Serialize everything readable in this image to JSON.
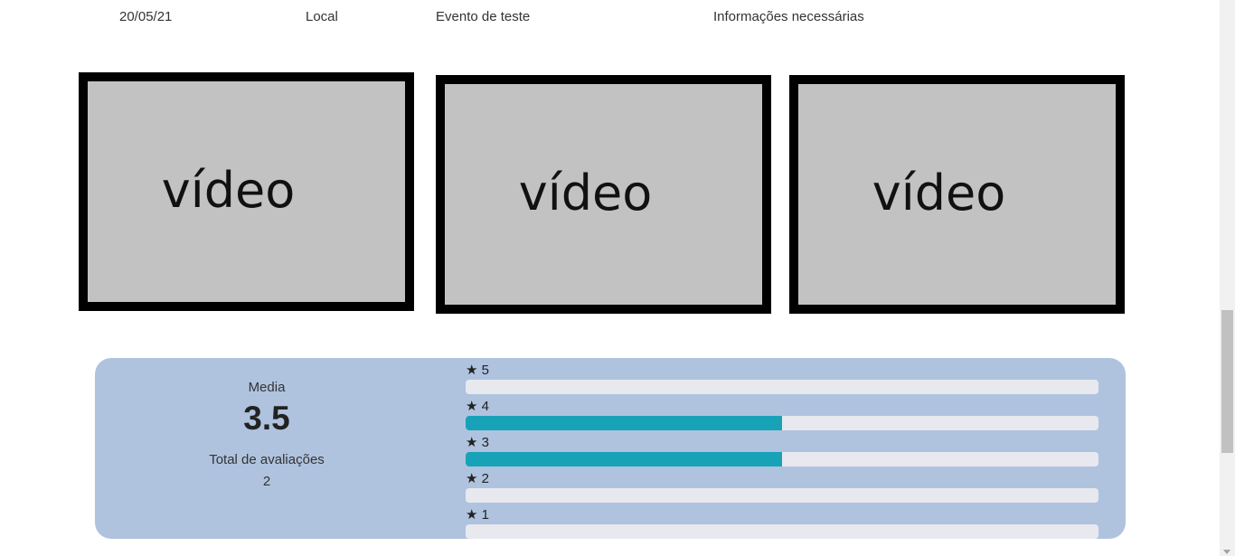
{
  "event_row": {
    "date": "20/05/21",
    "location": "Local",
    "event_name": "Evento de teste",
    "info": "Informações necessárias"
  },
  "videos": [
    {
      "label": "vídeo"
    },
    {
      "label": "vídeo"
    },
    {
      "label": "vídeo"
    }
  ],
  "rating": {
    "average_label": "Media",
    "average_value": "3.5",
    "total_label": "Total de avaliações",
    "total_value": "2",
    "star_icon": "★",
    "bars": [
      {
        "stars": "5",
        "fraction": 0
      },
      {
        "stars": "4",
        "fraction": 0.5
      },
      {
        "stars": "3",
        "fraction": 0.5
      },
      {
        "stars": "2",
        "fraction": 0
      },
      {
        "stars": "1",
        "fraction": 0
      }
    ],
    "bar_color": "#18a2b8",
    "panel_color": "#afc3df"
  }
}
